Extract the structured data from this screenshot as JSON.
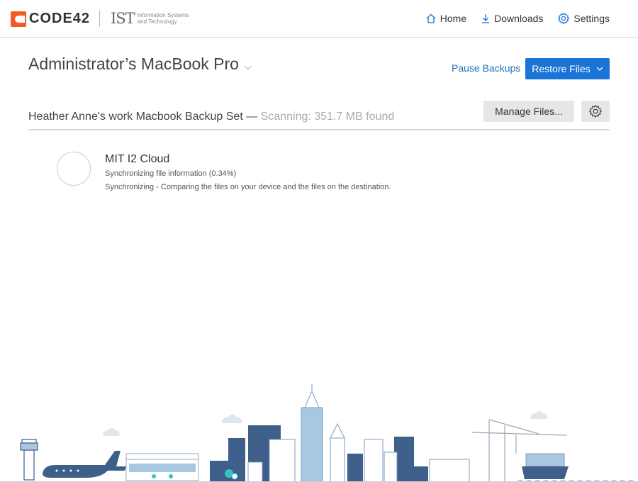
{
  "header": {
    "logo_text": "CODE42",
    "ist_mark": "IST",
    "ist_text": "Information Systems and Technology",
    "nav": [
      {
        "label": "Home",
        "icon": "home-icon"
      },
      {
        "label": "Downloads",
        "icon": "download-icon"
      },
      {
        "label": "Settings",
        "icon": "gear-icon"
      }
    ]
  },
  "device": {
    "title": "Administrator’s MacBook Pro",
    "pause_label": "Pause Backups",
    "restore_label": "Restore Files"
  },
  "backup_set": {
    "name": "Heather Anne's work Macbook Backup Set —",
    "status": "Scanning: 351.7 MB found",
    "manage_label": "Manage Files..."
  },
  "destination": {
    "name": "MIT I2 Cloud",
    "line1": "Synchronizing file information (0.34%)",
    "line2": "Synchronizing - Comparing the files on your device and the files on the destination."
  },
  "colors": {
    "accent": "#1a73d6",
    "brand": "#f15a22",
    "skyline_dark": "#3d5f8a",
    "skyline_light": "#a9c7e0"
  }
}
